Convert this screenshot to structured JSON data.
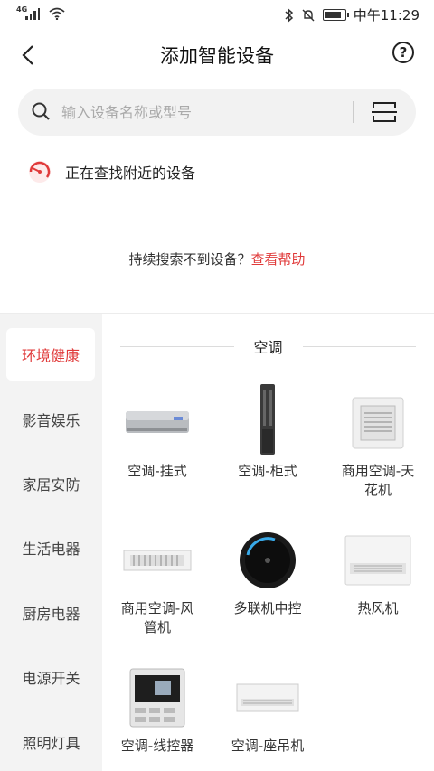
{
  "status_bar": {
    "network": "4G",
    "time": "中午11:29"
  },
  "header": {
    "title": "添加智能设备",
    "help_symbol": "?"
  },
  "search": {
    "placeholder": "输入设备名称或型号",
    "value": ""
  },
  "scanning": {
    "text": "正在查找附近的设备"
  },
  "help_hint": {
    "text": "持续搜索不到设备？",
    "link": "查看帮助"
  },
  "categories": [
    {
      "label": "环境健康",
      "active": true
    },
    {
      "label": "影音娱乐",
      "active": false
    },
    {
      "label": "家居安防",
      "active": false
    },
    {
      "label": "生活电器",
      "active": false
    },
    {
      "label": "厨房电器",
      "active": false
    },
    {
      "label": "电源开关",
      "active": false
    },
    {
      "label": "照明灯具",
      "active": false
    }
  ],
  "section": {
    "title": "空调",
    "devices": [
      {
        "name": "空调-挂式",
        "icon": "wall-ac-icon"
      },
      {
        "name": "空调-柜式",
        "icon": "tower-ac-icon"
      },
      {
        "name": "商用空调-天花机",
        "icon": "cassette-ac-icon"
      },
      {
        "name": "商用空调-风管机",
        "icon": "duct-ac-icon"
      },
      {
        "name": "多联机中控",
        "icon": "central-controller-icon"
      },
      {
        "name": "热风机",
        "icon": "heater-icon"
      },
      {
        "name": "空调-线控器",
        "icon": "wired-controller-icon"
      },
      {
        "name": "空调-座吊机",
        "icon": "ceiling-floor-ac-icon"
      }
    ]
  },
  "colors": {
    "accent": "#e03a3a",
    "sidebar_bg": "#f3f3f3",
    "search_bg": "#f2f2f2"
  }
}
